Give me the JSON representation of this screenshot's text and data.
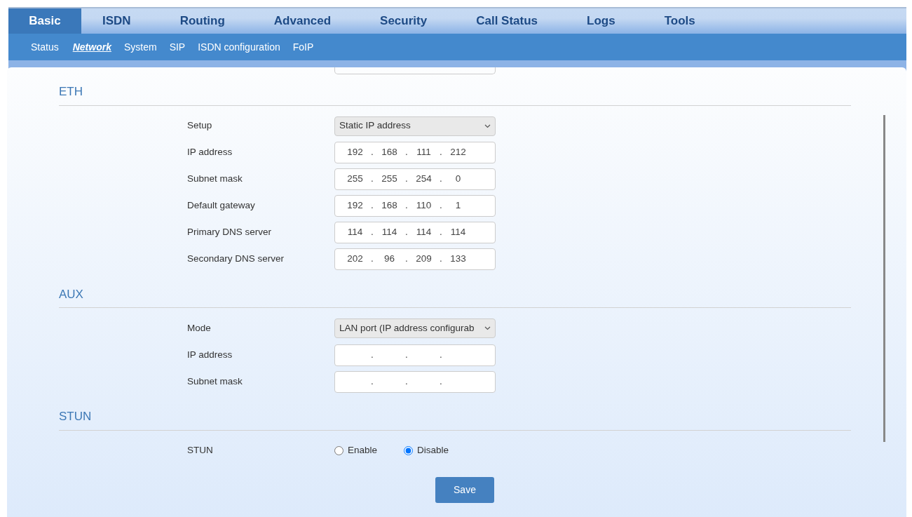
{
  "main_tabs": [
    {
      "label": "Basic",
      "selected": true
    },
    {
      "label": "ISDN",
      "selected": false
    },
    {
      "label": "Routing",
      "selected": false
    },
    {
      "label": "Advanced",
      "selected": false
    },
    {
      "label": "Security",
      "selected": false
    },
    {
      "label": "Call Status",
      "selected": false
    },
    {
      "label": "Logs",
      "selected": false
    },
    {
      "label": "Tools",
      "selected": false
    }
  ],
  "sub_tabs": [
    {
      "label": "Status",
      "selected": false
    },
    {
      "label": "Network",
      "selected": true
    },
    {
      "label": "System",
      "selected": false
    },
    {
      "label": "SIP",
      "selected": false
    },
    {
      "label": "ISDN configuration",
      "selected": false
    },
    {
      "label": "FoIP",
      "selected": false
    }
  ],
  "sections": [
    {
      "title": "ETH",
      "rows": [
        {
          "kind": "select",
          "label": "Setup",
          "value": "Static IP address"
        },
        {
          "kind": "ip",
          "label": "IP address",
          "separator": ".",
          "octets": [
            "192",
            "168",
            "111",
            "212"
          ]
        },
        {
          "kind": "ip",
          "label": "Subnet mask",
          "separator": ".",
          "octets": [
            "255",
            "255",
            "254",
            "0"
          ]
        },
        {
          "kind": "ip",
          "label": "Default gateway",
          "separator": ".",
          "octets": [
            "192",
            "168",
            "110",
            "1"
          ]
        },
        {
          "kind": "ip",
          "label": "Primary DNS server",
          "separator": ".",
          "octets": [
            "114",
            "114",
            "114",
            "114"
          ]
        },
        {
          "kind": "ip",
          "label": "Secondary DNS server",
          "separator": ".",
          "octets": [
            "202",
            "96",
            "209",
            "133"
          ]
        }
      ]
    },
    {
      "title": "AUX",
      "rows": [
        {
          "kind": "select",
          "label": "Mode",
          "value": "LAN port (IP address configurab"
        },
        {
          "kind": "ip",
          "label": "IP address",
          "separator": "."
        },
        {
          "kind": "ip",
          "label": "Subnet mask",
          "separator": "."
        }
      ]
    },
    {
      "title": "STUN",
      "rows": [
        {
          "kind": "radio",
          "label": "STUN",
          "options": [
            {
              "label": "Enable",
              "selected": false
            },
            {
              "label": "Disable",
              "selected": true
            }
          ]
        }
      ]
    }
  ],
  "save_button": "Save"
}
